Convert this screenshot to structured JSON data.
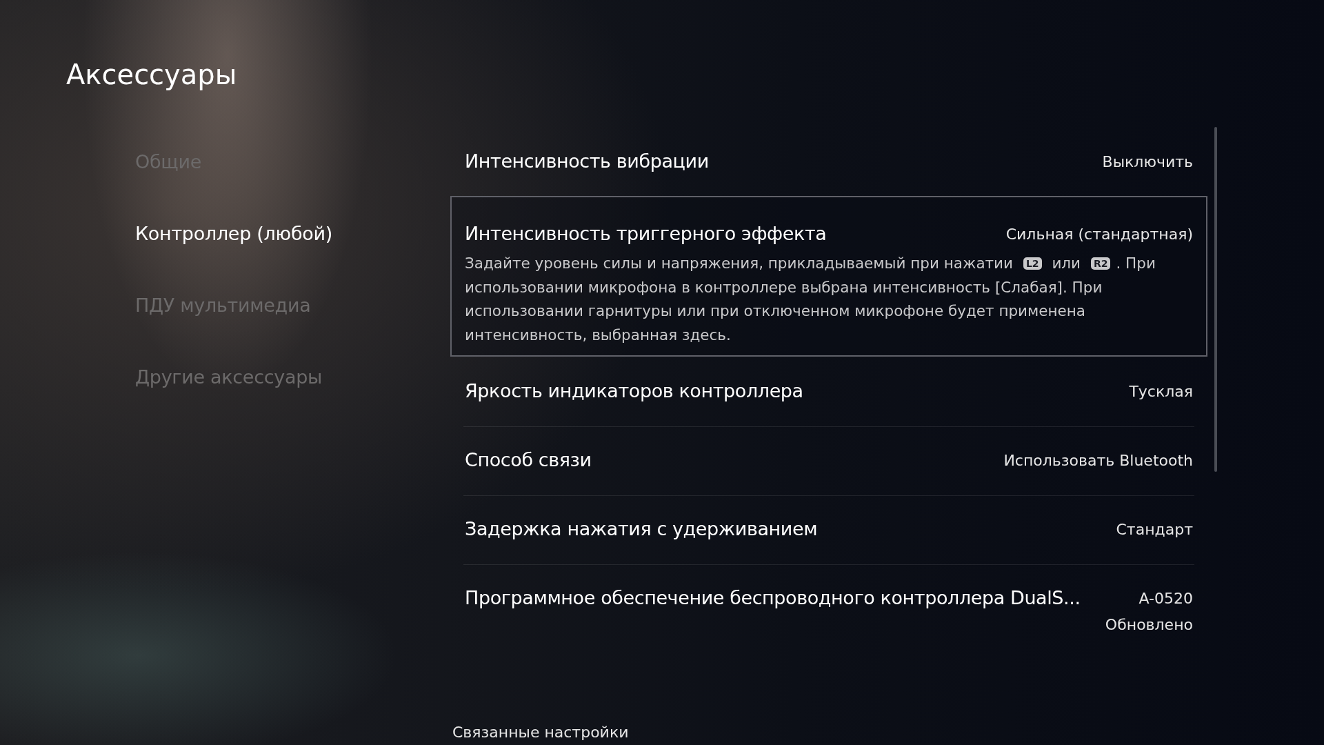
{
  "page_title": "Аксессуары",
  "sidebar": {
    "items": [
      {
        "label": "Общие",
        "selected": false
      },
      {
        "label": "Контроллер (любой)",
        "selected": true
      },
      {
        "label": "ПДУ мультимедиа",
        "selected": false
      },
      {
        "label": "Другие аксессуары",
        "selected": false
      }
    ]
  },
  "settings": [
    {
      "title": "Интенсивность вибрации",
      "values": [
        "Выключить"
      ],
      "selected": false
    },
    {
      "title": "Интенсивность триггерного эффекта",
      "values": [
        "Сильная (стандартная)"
      ],
      "selected": true,
      "description": [
        {
          "kind": "text",
          "text": "Задайте уровень силы и напряжения, прикладываемый при нажатии "
        },
        {
          "kind": "key",
          "text": "L2"
        },
        {
          "kind": "text",
          "text": " или "
        },
        {
          "kind": "key",
          "text": "R2"
        },
        {
          "kind": "text",
          "text": ". При использовании микрофона в контроллере выбрана интенсивность [Слабая]. При использовании гарнитуры или при отключенном микрофоне будет применена интенсивность, выбранная здесь."
        }
      ]
    },
    {
      "title": "Яркость индикаторов контроллера",
      "values": [
        "Тусклая"
      ],
      "selected": false
    },
    {
      "title": "Способ связи",
      "values": [
        "Использовать Bluetooth"
      ],
      "selected": false
    },
    {
      "title": "Задержка нажатия с удерживанием",
      "values": [
        "Стандарт"
      ],
      "selected": false
    },
    {
      "title": "Программное обеспечение беспроводного контроллера DualS...",
      "values": [
        "A-0520",
        "Обновлено"
      ],
      "selected": false
    }
  ],
  "related_settings": {
    "label": "Связанные настройки"
  }
}
